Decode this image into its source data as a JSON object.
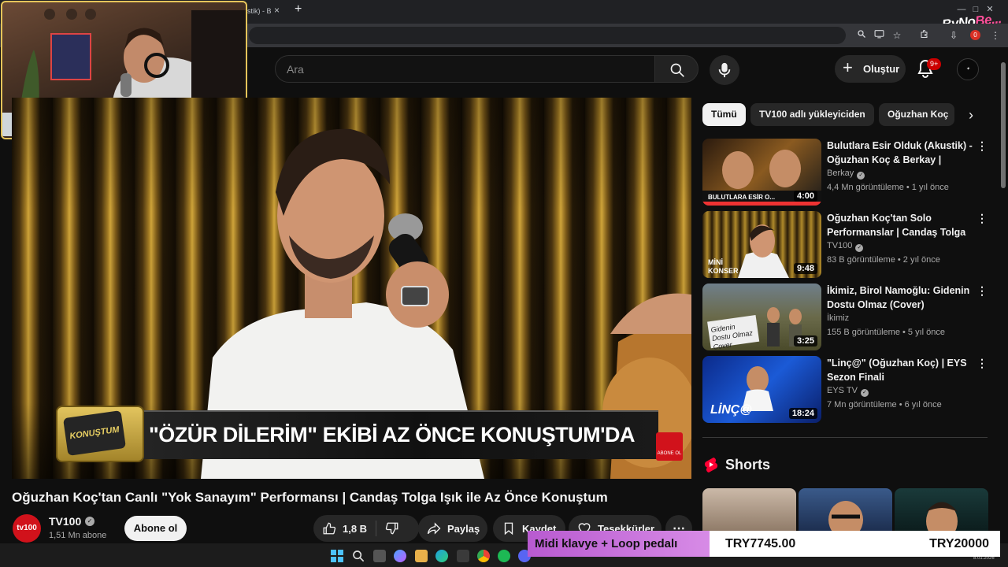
{
  "browser": {
    "tab_fragment": "stik) - B",
    "tab_close": "×",
    "new_tab": "+",
    "overlay_brand_a": "ByNo",
    "overlay_brand_b": "Be...",
    "profile_badge": "0"
  },
  "header": {
    "search_placeholder": "Ara",
    "create_label": "Oluştur",
    "notifications_badge": "9+"
  },
  "player": {
    "lower_third": "\"ÖZÜR DİLERİM\" EKİBİ AZ ÖNCE KONUŞTUM'DA",
    "show_logo": "KONUŞTUM",
    "corner_logo": "ABONE OL"
  },
  "video": {
    "title": "Oğuzhan Koç'tan Canlı \"Yok Sanayım\" Performansı | Candaş Tolga Işık ile Az Önce Konuştum",
    "channel_avatar": "tv100",
    "channel_name": "TV100",
    "subscribers": "1,51 Mn abone",
    "subscribe_label": "Abone ol",
    "like_count": "1,8 B",
    "share_label": "Paylaş",
    "save_label": "Kaydet",
    "thanks_label": "Teşekkürler"
  },
  "chips": [
    "Tümü",
    "TV100 adlı yükleyiciden",
    "Oğuzhan Koç"
  ],
  "recommendations": [
    {
      "title": "Bulutlara Esir Olduk (Akustik) - Oğuzhan Koç & Berkay | Evdey...",
      "channel": "Berkay",
      "meta": "4,4 Mn görüntüleme • 1 yıl önce",
      "duration": "4:00",
      "thumb_text": "BULUTLARA ESİR O..."
    },
    {
      "title": "Oğuzhan Koç'tan Solo Performanslar | Candaş Tolga ...",
      "channel": "TV100",
      "meta": "83 B görüntüleme • 2 yıl önce",
      "duration": "9:48",
      "thumb_text": "MİNİ KONSER"
    },
    {
      "title": "İkimiz, Birol Namoğlu: Gidenin Dostu Olmaz (Cover)",
      "channel": "İkimiz",
      "meta": "155 B görüntüleme • 5 yıl önce",
      "duration": "3:25",
      "thumb_text": "Gidenin Dostu Olmaz Cover"
    },
    {
      "title": "\"Linç@\" (Oğuzhan Koç) | EYS Sezon Finali",
      "channel": "EYS TV",
      "meta": "7 Mn görüntüleme • 6 yıl önce",
      "duration": "18:24",
      "thumb_text": "LİNÇ@"
    }
  ],
  "shorts": {
    "title": "Shorts"
  },
  "donation": {
    "goal_label": "Midi klavye + Loop pedalı",
    "current": "TRY7745.00",
    "target": "TRY20000"
  },
  "taskbar": {
    "date": "8.01.2026"
  },
  "colors": {
    "youtube_red": "#cc0000",
    "webcam_border": "#e5c45a",
    "donation_purple": "#b85ad0"
  }
}
